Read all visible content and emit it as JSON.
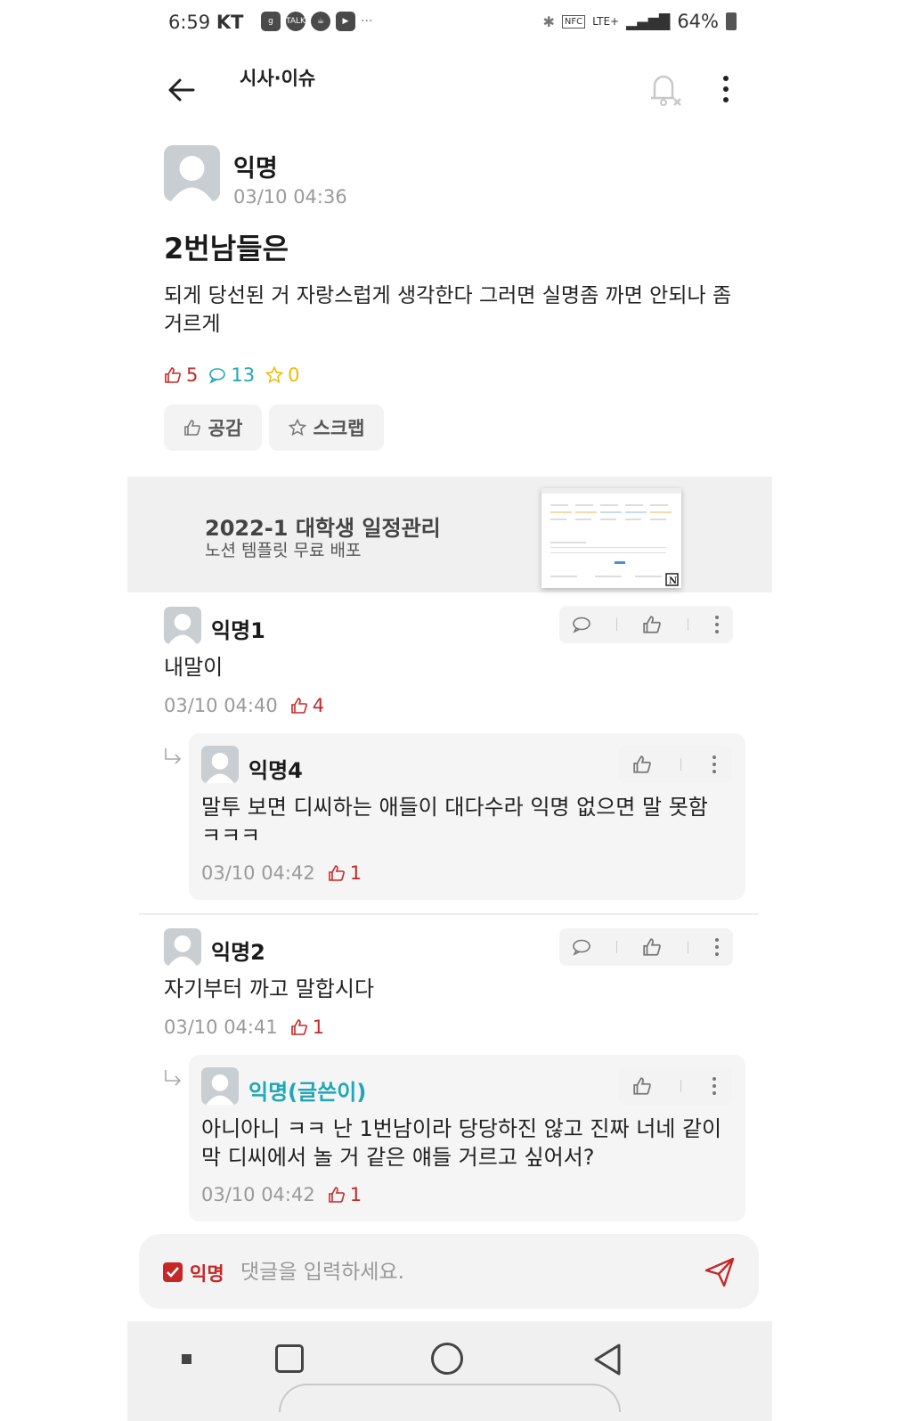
{
  "status_bar": {
    "time": "6:59",
    "carrier": "KT",
    "battery": "64%",
    "network": "LTE+"
  },
  "header": {
    "board": "시사·이슈"
  },
  "post": {
    "author": "익명",
    "time": "03/10 04:36",
    "title": "2번남들은",
    "body": "되게 당선된 거 자랑스럽게 생각한다 그러면 실명좀 까면 안되나 좀 거르게",
    "likes": "5",
    "comments": "13",
    "scraps": "0",
    "like_button": "공감",
    "scrap_button": "스크랩"
  },
  "ad": {
    "title": "2022-1 대학생 일정관리",
    "subtitle": "노션 템플릿 무료 배포"
  },
  "comments": [
    {
      "author": "익명1",
      "body": "내말이",
      "time": "03/10 04:40",
      "likes": "4",
      "replies": [
        {
          "author": "익명4",
          "body": "말투 보면 디씨하는 애들이 대다수라 익명 없으면 말 못함ㅋㅋㅋ",
          "time": "03/10 04:42",
          "likes": "1"
        }
      ]
    },
    {
      "author": "익명2",
      "body": "자기부터 까고 말합시다",
      "time": "03/10 04:41",
      "likes": "1",
      "replies": [
        {
          "author": "익명(글쓴이)",
          "body": "아니아니 ㅋㅋ 난 1번남이라 당당하진 않고 진짜 너네 같이 막 디씨에서 놀 거 같은 얘들 거르고 싶어서?",
          "time": "03/10 04:42",
          "likes": "1"
        }
      ]
    }
  ],
  "input": {
    "anonymous_label": "익명",
    "placeholder": "댓글을 입력하세요."
  },
  "colors": {
    "like": "#c62828",
    "comment": "#1ea7b7",
    "scrap": "#f5b800",
    "op": "#1ea7b7"
  }
}
